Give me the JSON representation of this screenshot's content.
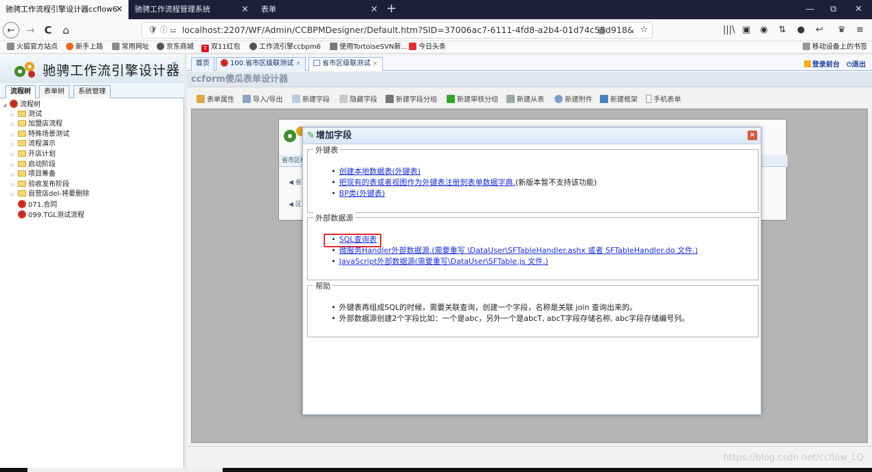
{
  "browser": {
    "tabs": [
      {
        "label": "驰骋工作流程引擎设计器ccflow6",
        "close": "×"
      },
      {
        "label": "驰骋工作流程管理系统",
        "close": "×"
      },
      {
        "label": "表单",
        "close": "×"
      }
    ],
    "new_tab": "+",
    "window": {
      "minimize": "—",
      "restore": "⧉",
      "close": "✕"
    },
    "nav": {
      "back": "←",
      "forward": "→",
      "reload": "C",
      "home": "⌂"
    },
    "url_prefix": "🛡 ⓘ ⚍",
    "url": "localhost:2207/WF/Admin/CCBPMDesigner/Default.htm?SID=37006ac7-6111-4fd8-a2b4-01d74c55d918&",
    "url_extras": "▦ ···",
    "star": "☆",
    "toolbar_icons": [
      "|||\\",
      "▣",
      "◉",
      "⇅",
      "●",
      "↩",
      "♛",
      "≡"
    ],
    "bookmarks": [
      "火狐官方站点",
      "新手上路",
      "常用网址",
      "京东商城",
      "双11红包",
      "工作流引擎ccbpm6",
      "使用TortoiseSVN新...",
      "今日头条"
    ],
    "mobile_bookmarks": "移动设备上的书签"
  },
  "left": {
    "title": "驰骋工作流引擎设计器",
    "collapse": "«",
    "tabs": [
      "流程树",
      "表单树",
      "系统管理"
    ],
    "tree_root": "流程树",
    "folders": [
      "测试",
      "加盟店流程",
      "特殊场景测试",
      "流程演示",
      "开店计划",
      "启动阶段",
      "项目筹备",
      "验收发布阶段",
      "自营店del-将要删除"
    ],
    "flows": [
      "071.合同",
      "099.TGL测试流程"
    ]
  },
  "main": {
    "tabs": [
      "首页",
      "100.省市区级联测试",
      "省市区级联测试"
    ],
    "tab_close": "×",
    "login_front": "登录前台",
    "logout": "退出",
    "designer_title": "ccform傻瓜表单设计器",
    "toolbar": [
      "表单属性",
      "导入/导出",
      "新建字段",
      "隐藏字段",
      "新建字段分组",
      "新建审核分组",
      "新建从表",
      "新建附件",
      "新建框架",
      "手机表单"
    ],
    "bg_header": "省市区级",
    "bg_rows": [
      "◀ 省",
      "◀ 区"
    ]
  },
  "dialog": {
    "title": "增加字段",
    "close": "×",
    "sections": [
      {
        "legend": "外键表",
        "items": [
          {
            "link": "创建本地数据表(外键表)",
            "suffix": ""
          },
          {
            "link": "把现有的表或者视图作为外键表注册到表单数据字典.",
            "suffix": "(新版本暂不支持该功能)"
          },
          {
            "link": "BP类(外键表)",
            "suffix": ""
          }
        ]
      },
      {
        "legend": "外部数据源",
        "items": [
          {
            "link": "SQL查询表",
            "suffix": ""
          },
          {
            "link": "微服务Handler外部数据源.(需要重写 \\DataUser\\SFTableHandler.ashx 或者 SFTableHandler.do 文件.)",
            "suffix": ""
          },
          {
            "link": "JavaScript外部数据源(需要重写\\DataUser\\SFTable.js 文件.)",
            "suffix": ""
          }
        ]
      },
      {
        "legend": "帮助",
        "items": [
          {
            "text": "外键表再组成SQL的时候，需要关联查询，创建一个字段，名称是关联 join 查询出来的。"
          },
          {
            "text": "外部数据源创建2个字段比如：一个是abc，另外一个是abcT, abcT字段存储名称, abc字段存储编号列。"
          }
        ]
      }
    ]
  },
  "watermark": "https://blog.csdn.net/ccflow_LQ",
  "colors": {
    "accent": "#1b2fd6",
    "highlight": "#e42b2b",
    "titlebar": "#1f1f3a"
  }
}
